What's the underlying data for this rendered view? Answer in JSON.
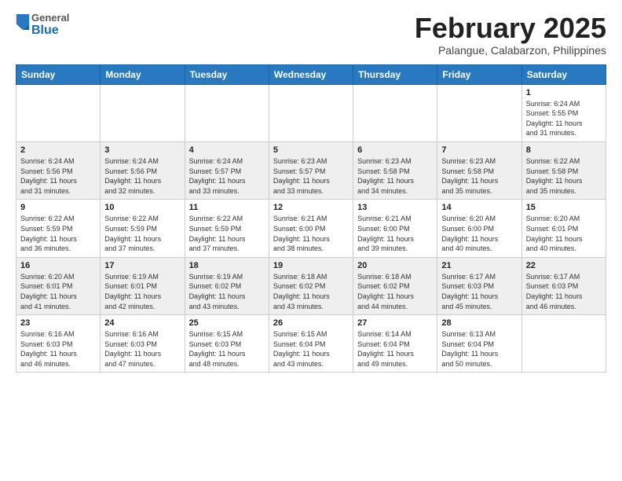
{
  "header": {
    "logo_general": "General",
    "logo_blue": "Blue",
    "month_title": "February 2025",
    "location": "Palangue, Calabarzon, Philippines"
  },
  "days_of_week": [
    "Sunday",
    "Monday",
    "Tuesday",
    "Wednesday",
    "Thursday",
    "Friday",
    "Saturday"
  ],
  "weeks": [
    [
      {
        "day": "",
        "info": ""
      },
      {
        "day": "",
        "info": ""
      },
      {
        "day": "",
        "info": ""
      },
      {
        "day": "",
        "info": ""
      },
      {
        "day": "",
        "info": ""
      },
      {
        "day": "",
        "info": ""
      },
      {
        "day": "1",
        "info": "Sunrise: 6:24 AM\nSunset: 5:55 PM\nDaylight: 11 hours\nand 31 minutes."
      }
    ],
    [
      {
        "day": "2",
        "info": "Sunrise: 6:24 AM\nSunset: 5:56 PM\nDaylight: 11 hours\nand 31 minutes."
      },
      {
        "day": "3",
        "info": "Sunrise: 6:24 AM\nSunset: 5:56 PM\nDaylight: 11 hours\nand 32 minutes."
      },
      {
        "day": "4",
        "info": "Sunrise: 6:24 AM\nSunset: 5:57 PM\nDaylight: 11 hours\nand 33 minutes."
      },
      {
        "day": "5",
        "info": "Sunrise: 6:23 AM\nSunset: 5:57 PM\nDaylight: 11 hours\nand 33 minutes."
      },
      {
        "day": "6",
        "info": "Sunrise: 6:23 AM\nSunset: 5:58 PM\nDaylight: 11 hours\nand 34 minutes."
      },
      {
        "day": "7",
        "info": "Sunrise: 6:23 AM\nSunset: 5:58 PM\nDaylight: 11 hours\nand 35 minutes."
      },
      {
        "day": "8",
        "info": "Sunrise: 6:22 AM\nSunset: 5:58 PM\nDaylight: 11 hours\nand 35 minutes."
      }
    ],
    [
      {
        "day": "9",
        "info": "Sunrise: 6:22 AM\nSunset: 5:59 PM\nDaylight: 11 hours\nand 36 minutes."
      },
      {
        "day": "10",
        "info": "Sunrise: 6:22 AM\nSunset: 5:59 PM\nDaylight: 11 hours\nand 37 minutes."
      },
      {
        "day": "11",
        "info": "Sunrise: 6:22 AM\nSunset: 5:59 PM\nDaylight: 11 hours\nand 37 minutes."
      },
      {
        "day": "12",
        "info": "Sunrise: 6:21 AM\nSunset: 6:00 PM\nDaylight: 11 hours\nand 38 minutes."
      },
      {
        "day": "13",
        "info": "Sunrise: 6:21 AM\nSunset: 6:00 PM\nDaylight: 11 hours\nand 39 minutes."
      },
      {
        "day": "14",
        "info": "Sunrise: 6:20 AM\nSunset: 6:00 PM\nDaylight: 11 hours\nand 40 minutes."
      },
      {
        "day": "15",
        "info": "Sunrise: 6:20 AM\nSunset: 6:01 PM\nDaylight: 11 hours\nand 40 minutes."
      }
    ],
    [
      {
        "day": "16",
        "info": "Sunrise: 6:20 AM\nSunset: 6:01 PM\nDaylight: 11 hours\nand 41 minutes."
      },
      {
        "day": "17",
        "info": "Sunrise: 6:19 AM\nSunset: 6:01 PM\nDaylight: 11 hours\nand 42 minutes."
      },
      {
        "day": "18",
        "info": "Sunrise: 6:19 AM\nSunset: 6:02 PM\nDaylight: 11 hours\nand 43 minutes."
      },
      {
        "day": "19",
        "info": "Sunrise: 6:18 AM\nSunset: 6:02 PM\nDaylight: 11 hours\nand 43 minutes."
      },
      {
        "day": "20",
        "info": "Sunrise: 6:18 AM\nSunset: 6:02 PM\nDaylight: 11 hours\nand 44 minutes."
      },
      {
        "day": "21",
        "info": "Sunrise: 6:17 AM\nSunset: 6:03 PM\nDaylight: 11 hours\nand 45 minutes."
      },
      {
        "day": "22",
        "info": "Sunrise: 6:17 AM\nSunset: 6:03 PM\nDaylight: 11 hours\nand 46 minutes."
      }
    ],
    [
      {
        "day": "23",
        "info": "Sunrise: 6:16 AM\nSunset: 6:03 PM\nDaylight: 11 hours\nand 46 minutes."
      },
      {
        "day": "24",
        "info": "Sunrise: 6:16 AM\nSunset: 6:03 PM\nDaylight: 11 hours\nand 47 minutes."
      },
      {
        "day": "25",
        "info": "Sunrise: 6:15 AM\nSunset: 6:03 PM\nDaylight: 11 hours\nand 48 minutes."
      },
      {
        "day": "26",
        "info": "Sunrise: 6:15 AM\nSunset: 6:04 PM\nDaylight: 11 hours\nand 43 minutes."
      },
      {
        "day": "27",
        "info": "Sunrise: 6:14 AM\nSunset: 6:04 PM\nDaylight: 11 hours\nand 49 minutes."
      },
      {
        "day": "28",
        "info": "Sunrise: 6:13 AM\nSunset: 6:04 PM\nDaylight: 11 hours\nand 50 minutes."
      },
      {
        "day": "",
        "info": ""
      }
    ]
  ]
}
